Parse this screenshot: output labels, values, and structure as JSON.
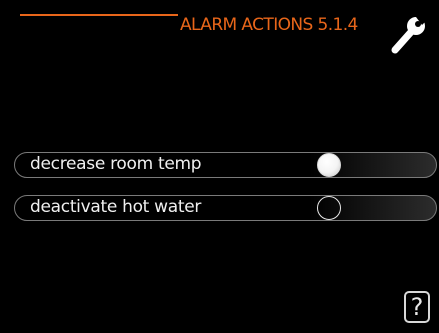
{
  "header": {
    "title": "ALARM ACTIONS 5.1.4",
    "accent_color": "#e8661a",
    "icon": "wrench-icon"
  },
  "options": [
    {
      "label": "decrease room temp",
      "selected": true
    },
    {
      "label": "deactivate hot water",
      "selected": false
    }
  ],
  "help": {
    "label": "?",
    "icon": "help-icon"
  }
}
